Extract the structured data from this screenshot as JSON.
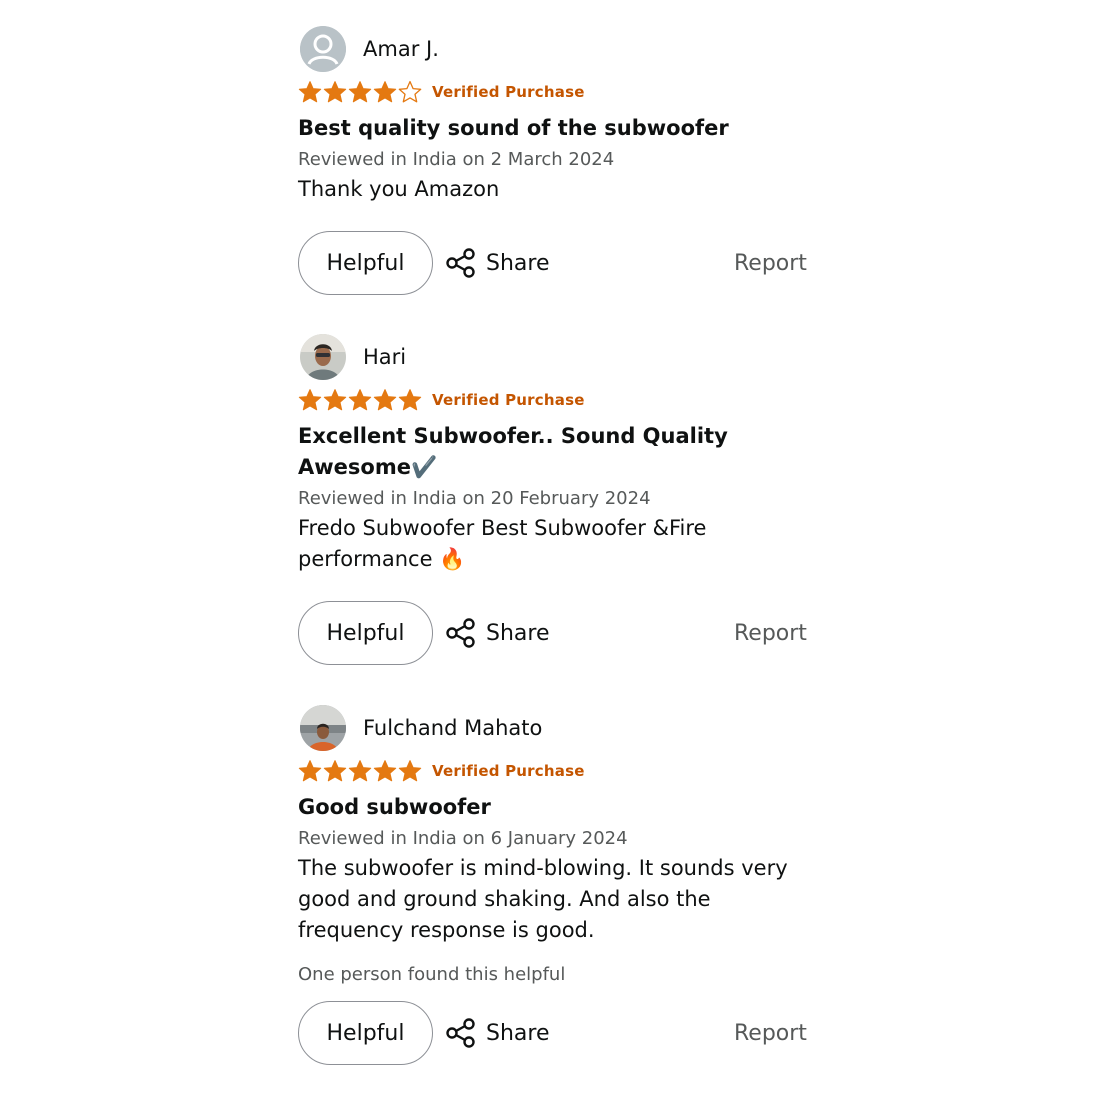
{
  "reviews": [
    {
      "reviewer": "Amar J.",
      "avatar": "default-profile-icon",
      "rating": 4,
      "rating_max": 5,
      "verified": "Verified Purchase",
      "title": "Best quality sound of the subwoofer",
      "meta": "Reviewed in India on 2 March 2024",
      "body": "Thank you Amazon",
      "helpful_count": "",
      "helpful_label": "Helpful",
      "share_label": "Share",
      "report_label": "Report"
    },
    {
      "reviewer": "Hari",
      "avatar": "user-photo",
      "rating": 5,
      "rating_max": 5,
      "verified": "Verified Purchase",
      "title": "Excellent Subwoofer.. Sound Quality Awesome✔️",
      "meta": "Reviewed in India on 20 February 2024",
      "body": "Fredo Subwoofer Best Subwoofer &Fire performance 🔥",
      "helpful_count": "",
      "helpful_label": "Helpful",
      "share_label": "Share",
      "report_label": "Report"
    },
    {
      "reviewer": "Fulchand Mahato",
      "avatar": "user-photo",
      "rating": 5,
      "rating_max": 5,
      "verified": "Verified Purchase",
      "title": "Good subwoofer",
      "meta": "Reviewed in India on 6 January 2024",
      "body": "The subwoofer is mind-blowing. It sounds very good and ground shaking. And also the frequency response is good.",
      "helpful_count": "One person found this helpful",
      "helpful_label": "Helpful",
      "share_label": "Share",
      "report_label": "Report"
    }
  ],
  "colors": {
    "star_fill": "#e47911",
    "verified_text": "#c45500",
    "secondary_text": "#565959",
    "button_border": "#8d9096"
  }
}
